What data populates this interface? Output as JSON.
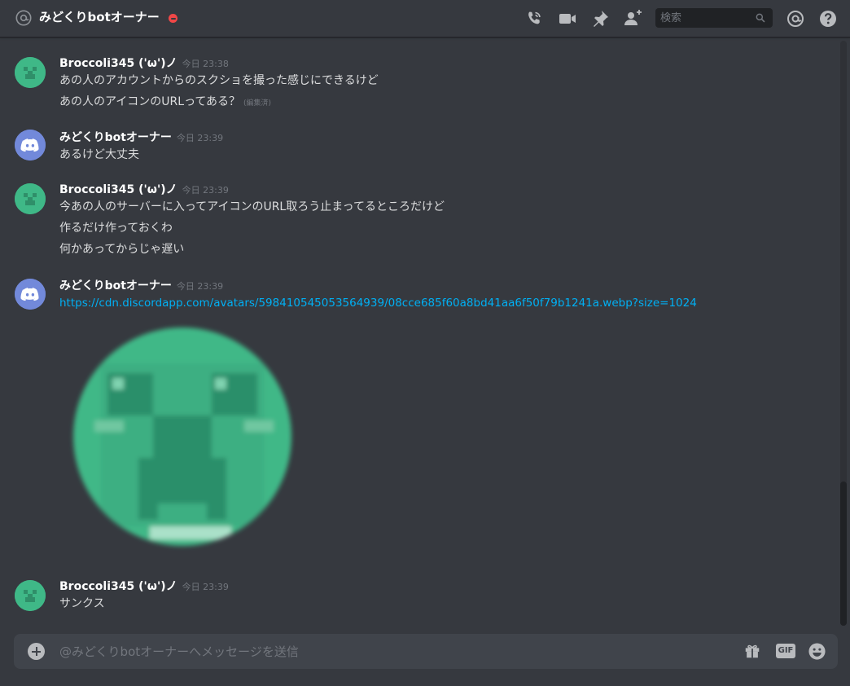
{
  "header": {
    "title": "みどくりbotオーナー",
    "search_placeholder": "検索"
  },
  "messages": [
    {
      "author": "Broccoli345 ('ω')ノ",
      "timestamp": "今日 23:38",
      "avatar": "creeper",
      "lines": [
        "あの人のアカウントからのスクショを撮った感じにできるけど",
        "あの人のアイコンのURLってある？"
      ],
      "edited_label": "(編集済)"
    },
    {
      "author": "みどくりbotオーナー",
      "timestamp": "今日 23:39",
      "avatar": "discord",
      "lines": [
        "あるけど大丈夫"
      ]
    },
    {
      "author": "Broccoli345 ('ω')ノ",
      "timestamp": "今日 23:39",
      "avatar": "creeper",
      "lines": [
        "今あの人のサーバーに入ってアイコンのURL取ろう止まってるところだけど",
        "作るだけ作っておくわ",
        "何かあってからじゃ遅い"
      ]
    },
    {
      "author": "みどくりbotオーナー",
      "timestamp": "今日 23:39",
      "avatar": "discord",
      "link": "https://cdn.discordapp.com/avatars/598410545053564939/08cce685f60a8bd41aa6f50f79b1241a.webp?size=1024",
      "embed": "creeper-avatar-image"
    },
    {
      "author": "Broccoli345 ('ω')ノ",
      "timestamp": "今日 23:39",
      "avatar": "creeper",
      "lines": [
        "サンクス"
      ]
    }
  ],
  "composer": {
    "placeholder": "@みどくりbotオーナーへメッセージを送信",
    "gif_label": "GIF"
  },
  "icons": [
    "at-icon",
    "dnd-status-icon",
    "call-icon",
    "video-icon",
    "pin-icon",
    "add-friend-icon",
    "search-icon",
    "mention-icon",
    "help-icon",
    "plus-icon",
    "gift-icon",
    "gif-icon",
    "emoji-icon"
  ],
  "colors": {
    "background": "#36393f",
    "link": "#00b0f4",
    "creeper_green": "#3fb887",
    "discord_blurple": "#7289da",
    "dnd_red": "#f04747"
  }
}
